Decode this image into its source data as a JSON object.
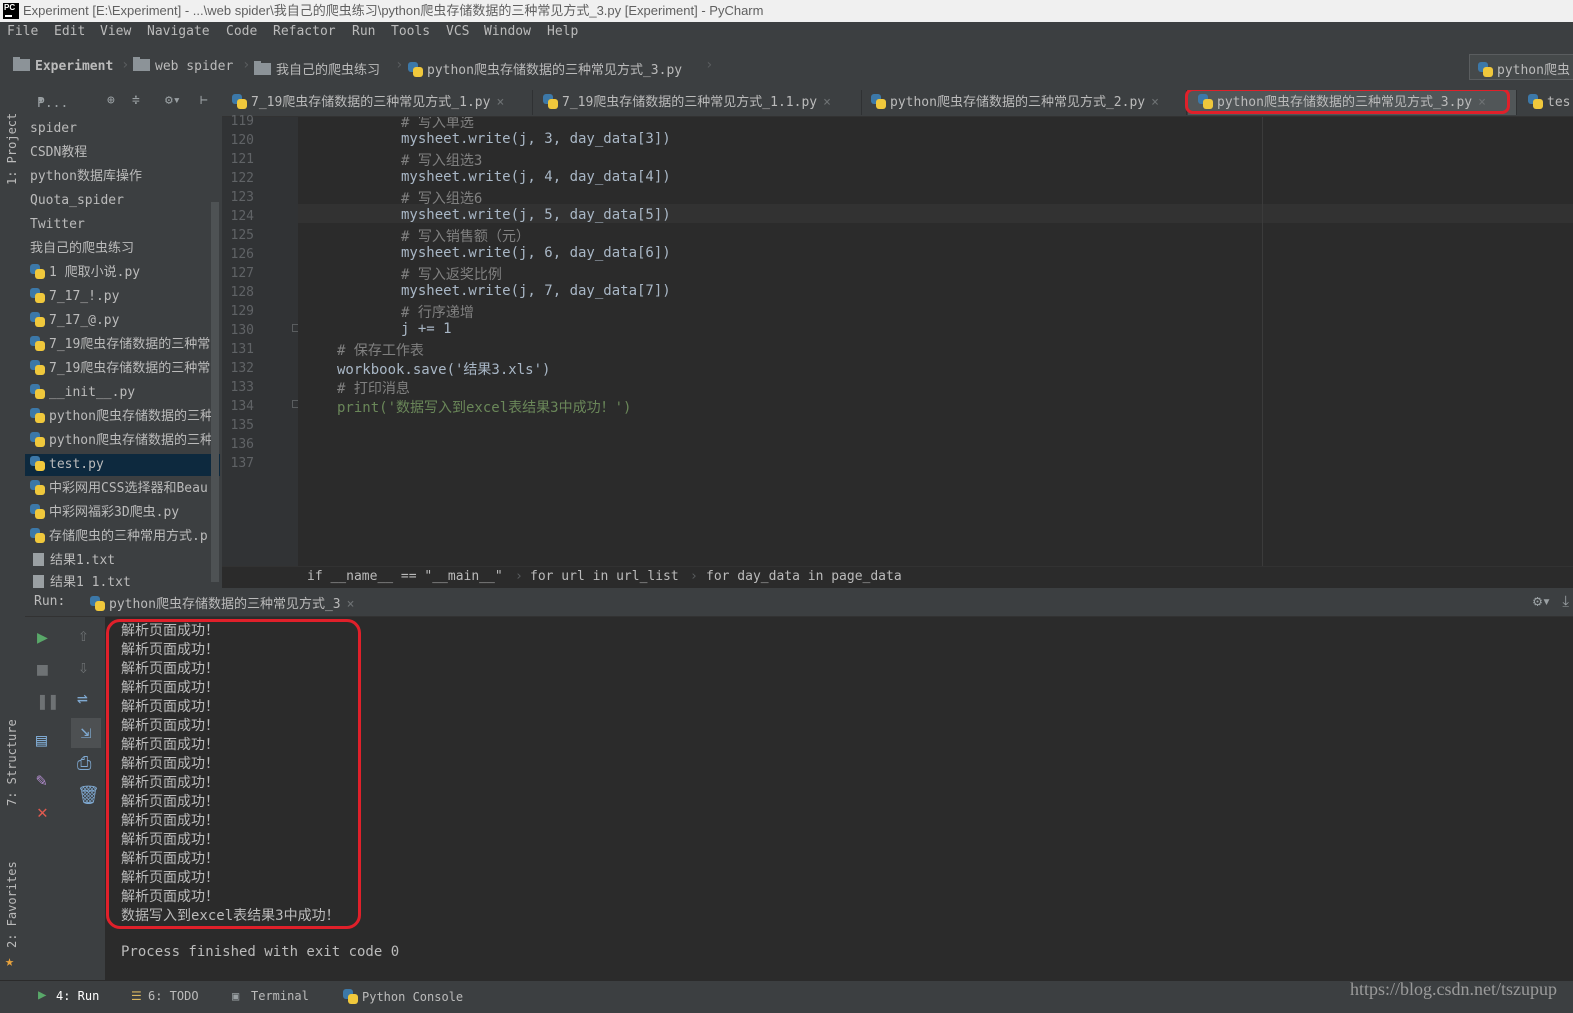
{
  "window": {
    "title": "Experiment [E:\\Experiment] - ...\\web spider\\我自己的爬虫练习\\python爬虫存储数据的三种常见方式_3.py [Experiment] - PyCharm"
  },
  "menu": [
    "File",
    "Edit",
    "View",
    "Navigate",
    "Code",
    "Refactor",
    "Run",
    "Tools",
    "VCS",
    "Window",
    "Help"
  ],
  "nav": {
    "crumbs": [
      "Experiment",
      "web spider",
      "我自己的爬虫练习",
      "python爬虫存储数据的三种常见方式_3.py"
    ],
    "run_config": "python爬虫"
  },
  "left_stripe": {
    "project": "1: Project",
    "structure": "7: Structure",
    "favorites": "2: Favorites"
  },
  "project": {
    "toolbar_label": "P...",
    "items": [
      {
        "label": "spider",
        "type": "folder"
      },
      {
        "label": "CSDN教程",
        "type": "folder"
      },
      {
        "label": "python数据库操作",
        "type": "folder"
      },
      {
        "label": "Quota_spider",
        "type": "folder"
      },
      {
        "label": "Twitter",
        "type": "folder"
      },
      {
        "label": "我自己的爬虫练习",
        "type": "folder"
      },
      {
        "label": "1 爬取小说.py",
        "type": "py"
      },
      {
        "label": "7_17_!.py",
        "type": "py"
      },
      {
        "label": "7_17_@.py",
        "type": "py"
      },
      {
        "label": "7_19爬虫存储数据的三种常",
        "type": "py"
      },
      {
        "label": "7_19爬虫存储数据的三种常",
        "type": "py"
      },
      {
        "label": "__init__.py",
        "type": "py"
      },
      {
        "label": "python爬虫存储数据的三种",
        "type": "py"
      },
      {
        "label": "python爬虫存储数据的三种",
        "type": "py"
      },
      {
        "label": "test.py",
        "type": "py"
      },
      {
        "label": "中彩网用CSS选择器和Beau",
        "type": "py"
      },
      {
        "label": "中彩网福彩3D爬虫.py",
        "type": "py"
      },
      {
        "label": "存储爬虫的三种常用方式.p",
        "type": "py"
      },
      {
        "label": "结果1.txt",
        "type": "txt"
      },
      {
        "label": "结果1_1.txt",
        "type": "txt"
      }
    ]
  },
  "tabs": [
    {
      "label": "7_19爬虫存储数据的三种常见方式_1.py"
    },
    {
      "label": "7_19爬虫存储数据的三种常见方式_1.1.py"
    },
    {
      "label": "python爬虫存储数据的三种常见方式_2.py"
    },
    {
      "label": "python爬虫存储数据的三种常见方式_3.py"
    },
    {
      "label": "tes"
    }
  ],
  "editor": {
    "lines": [
      {
        "n": "119",
        "code": "# 写入单选"
      },
      {
        "n": "120",
        "code": "mysheet.write(j, 3, day_data[3])"
      },
      {
        "n": "121",
        "code": "# 写入组选3"
      },
      {
        "n": "122",
        "code": "mysheet.write(j, 4, day_data[4])"
      },
      {
        "n": "123",
        "code": "# 写入组选6"
      },
      {
        "n": "124",
        "code": "mysheet.write(j, 5, day_data[5])"
      },
      {
        "n": "125",
        "code": "# 写入销售额（元）"
      },
      {
        "n": "126",
        "code": "mysheet.write(j, 6, day_data[6])"
      },
      {
        "n": "127",
        "code": "# 写入返奖比例"
      },
      {
        "n": "128",
        "code": "mysheet.write(j, 7, day_data[7])"
      },
      {
        "n": "129",
        "code": "# 行序递增"
      },
      {
        "n": "130",
        "code": "j += 1"
      },
      {
        "n": "131",
        "code": "# 保存工作表"
      },
      {
        "n": "132",
        "code": "workbook.save('结果3.xls')"
      },
      {
        "n": "133",
        "code": "# 打印消息"
      },
      {
        "n": "134",
        "code": "print('数据写入到excel表结果3中成功！')"
      },
      {
        "n": "135",
        "code": ""
      },
      {
        "n": "136",
        "code": ""
      },
      {
        "n": "137",
        "code": ""
      }
    ]
  },
  "breadcrumb": [
    "if __name__ == \"__main__\"",
    "for url in url_list",
    "for day_data in page_data"
  ],
  "run": {
    "label": "Run:",
    "config": "python爬虫存储数据的三种常见方式_3",
    "output": [
      "解析页面成功！",
      "解析页面成功！",
      "解析页面成功！",
      "解析页面成功！",
      "解析页面成功！",
      "解析页面成功！",
      "解析页面成功！",
      "解析页面成功！",
      "解析页面成功！",
      "解析页面成功！",
      "解析页面成功！",
      "解析页面成功！",
      "解析页面成功！",
      "解析页面成功！",
      "解析页面成功！",
      "数据写入到excel表结果3中成功！"
    ],
    "exit": "Process finished with exit code 0"
  },
  "status": {
    "run": "4: Run",
    "todo": "6: TODO",
    "terminal": "Terminal",
    "console": "Python Console",
    "watermark": "https://blog.csdn.net/tszupup"
  },
  "colors": {
    "accent_red": "#e0202a",
    "keyword": "#cc7832",
    "string": "#6a8759",
    "number": "#6897bb",
    "comment": "#808080"
  }
}
